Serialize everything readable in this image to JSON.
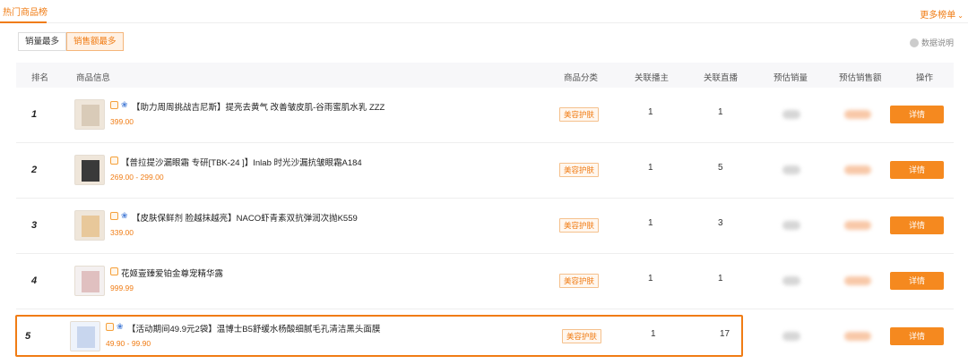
{
  "header": {
    "tab": "热门商品榜",
    "more": "更多榜单"
  },
  "toggle": {
    "by_volume": "销量最多",
    "by_sales": "销售额最多"
  },
  "data_note": "数据说明",
  "columns": {
    "rank": "排名",
    "info": "商品信息",
    "category": "商品分类",
    "related_anchor": "关联播主",
    "related_live": "关联直播",
    "est_volume": "预估销量",
    "est_sales": "预估销售额",
    "action": "操作"
  },
  "rows": [
    {
      "rank": "1",
      "title": "【助力周周挑战吉尼斯】提亮去黄气 改善皱皮肌-谷雨蜜肌水乳 ZZZ",
      "price": "399.00",
      "category": "美容护肤",
      "anchors": "1",
      "lives": "1",
      "detail": "详情"
    },
    {
      "rank": "2",
      "title": "【普拉提沙漏眼霜 专研[TBK-24 ]】Inlab 时光沙漏抗皱眼霜A184",
      "price": "269.00 - 299.00",
      "category": "美容护肤",
      "anchors": "1",
      "lives": "5",
      "detail": "详情"
    },
    {
      "rank": "3",
      "title": "【皮肤保鲜剂 脸越抹越亮】NACO虾青素双抗弹润次抛K559",
      "price": "339.00",
      "category": "美容护肤",
      "anchors": "1",
      "lives": "3",
      "detail": "详情"
    },
    {
      "rank": "4",
      "title": "花姬壹臻爱铂金尊宠精华露",
      "price": "999.99",
      "category": "美容护肤",
      "anchors": "1",
      "lives": "1",
      "detail": "详情"
    },
    {
      "rank": "5",
      "title": "【活动期间49.9元2袋】温博士B5舒缓水杨酸细腻毛孔清洁黑头面膜",
      "price": "49.90 - 99.90",
      "category": "美容护肤",
      "anchors": "1",
      "lives": "17",
      "detail": "详情"
    }
  ]
}
